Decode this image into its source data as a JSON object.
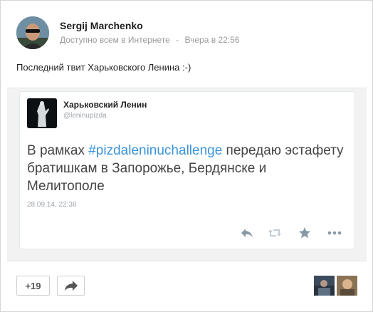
{
  "post": {
    "author": "Sergij Marchenko",
    "visibility": "Доступно всем в Интернете",
    "separator": "-",
    "time": "Вчера в 22:56",
    "text": "Последний твит Харьковского Ленина :-)"
  },
  "tweet": {
    "name": "Харьковский Ленин",
    "handle": "@leninupizda",
    "text_before": "В рамках ",
    "hashtag": "#pizdaleninuchallenge",
    "text_after": " передаю эстафету братишкам в Запорожье, Бердянске и Мелитополе",
    "date": "28.09.14, 22:38",
    "actions": [
      "reply-icon",
      "retweet-icon",
      "favorite-icon",
      "more-icon"
    ]
  },
  "footer": {
    "plus_label": "+19",
    "share_icon": "share-arrow-icon",
    "thumbnails": [
      "user-photo-1",
      "user-photo-2"
    ]
  },
  "colors": {
    "hashtag": "#3b94d9",
    "meta": "#999999",
    "action_icon": "#8899a6"
  }
}
